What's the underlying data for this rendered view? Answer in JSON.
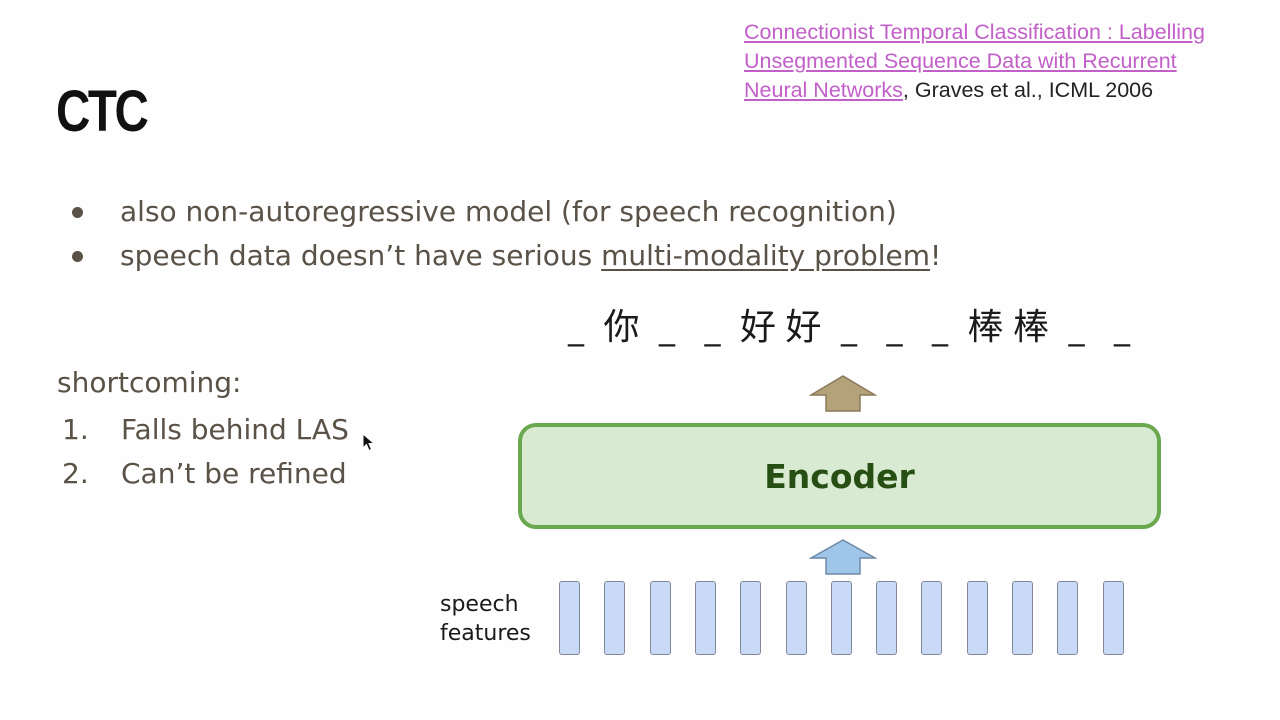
{
  "slide": {
    "title": "CTC",
    "reference": {
      "link_text_1": "Connectionist Temporal Classification : Labelling",
      "link_text_2": "Unsegmented Sequence Data with Recurrent",
      "link_text_3": "Neural Networks",
      "citation": ", Graves et al., ICML 2006",
      "link_color": "#c25fc9"
    },
    "bullets": [
      {
        "text": "also non-autoregressive model (for speech recognition)"
      },
      {
        "text_before": "speech data doesn’t have serious ",
        "underlined": "multi-modality problem",
        "text_after": "!"
      }
    ],
    "shortcoming": {
      "title": "shortcoming:",
      "items": [
        {
          "num": "1.",
          "text": "Falls behind LAS"
        },
        {
          "num": "2.",
          "text": "Can’t be refined"
        }
      ]
    },
    "diagram": {
      "output_tokens": [
        "_",
        "你",
        "_",
        "_",
        "好",
        "好",
        "_",
        "_",
        "_",
        "棒",
        "棒",
        "_",
        "_"
      ],
      "encoder_label": "Encoder",
      "input_label_line1": "speech",
      "input_label_line2": "features",
      "feature_count": 13,
      "colors": {
        "encoder_fill": "#d8ead2",
        "encoder_border": "#6aa84f",
        "encoder_text": "#274e13",
        "input_arrow": "#9fc5e8",
        "output_arrow": "#b3a27a",
        "feature_fill": "#c9daf8"
      }
    },
    "text_color": "#5a5147"
  }
}
